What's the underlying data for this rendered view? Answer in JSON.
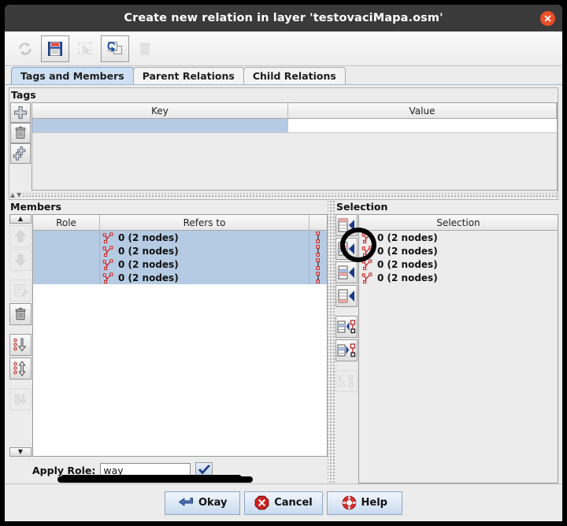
{
  "window": {
    "title": "Create new relation in layer 'testovaciMapa.osm'",
    "close_icon": "close-icon",
    "close_color": "#e8502a"
  },
  "toolbar": {
    "buttons": [
      {
        "name": "refresh-button",
        "icon": "refresh-icon",
        "enabled": false
      },
      {
        "name": "save-button",
        "icon": "save-floppy-icon",
        "enabled": true
      },
      {
        "name": "select-button",
        "icon": "select-cursor-icon",
        "enabled": false
      },
      {
        "name": "duplicate-button",
        "icon": "duplicate-icon",
        "enabled": true
      },
      {
        "name": "delete-button",
        "icon": "trash-icon",
        "enabled": false
      }
    ]
  },
  "tabs": [
    {
      "label": "Tags and Members",
      "active": true
    },
    {
      "label": "Parent Relations",
      "active": false
    },
    {
      "label": "Child Relations",
      "active": false
    }
  ],
  "tags": {
    "title": "Tags",
    "columns": [
      "Key",
      "Value"
    ],
    "rows": [
      {
        "key": "",
        "value": ""
      }
    ],
    "buttons": [
      {
        "name": "add-tag-button",
        "icon": "plus-icon",
        "enabled": true
      },
      {
        "name": "delete-tag-button",
        "icon": "trash-icon",
        "enabled": true
      },
      {
        "name": "add-many-tags-button",
        "icon": "multi-plus-icon",
        "enabled": true
      }
    ]
  },
  "members": {
    "title": "Members",
    "columns": [
      "Role",
      "Refers to",
      ""
    ],
    "rows": [
      {
        "role": "",
        "refers_to": "0 (2 nodes)",
        "icon": "way-icon",
        "link_icon": "two-nodes-icon",
        "selected": true
      },
      {
        "role": "",
        "refers_to": "0 (2 nodes)",
        "icon": "way-icon",
        "link_icon": "two-nodes-icon",
        "selected": true
      },
      {
        "role": "",
        "refers_to": "0 (2 nodes)",
        "icon": "way-icon",
        "link_icon": "two-nodes-icon",
        "selected": true
      },
      {
        "role": "",
        "refers_to": "0 (2 nodes)",
        "icon": "way-icon",
        "link_icon": "two-nodes-icon",
        "selected": true
      }
    ],
    "selected_row_color": "#b5cbe3",
    "rail_buttons": [
      {
        "name": "scroll-up-button",
        "icon": "triangle-up-icon",
        "enabled": true
      },
      {
        "name": "move-member-up-button",
        "icon": "arrow-up-icon",
        "enabled": false
      },
      {
        "name": "move-member-down-button",
        "icon": "arrow-down-icon",
        "enabled": false
      },
      {
        "name": "edit-member-button",
        "icon": "edit-note-icon",
        "enabled": false
      },
      {
        "name": "remove-member-button",
        "icon": "trash-icon",
        "enabled": true
      },
      {
        "name": "sort-members-button",
        "icon": "sort-down-icon",
        "enabled": true
      },
      {
        "name": "reverse-members-button",
        "icon": "reverse-updown-icon",
        "enabled": true
      },
      {
        "name": "download-members-button",
        "icon": "download-icon",
        "enabled": false
      },
      {
        "name": "scroll-down-button",
        "icon": "triangle-down-icon",
        "enabled": true
      }
    ],
    "apply_role": {
      "label": "Apply Role:",
      "value": "way",
      "placeholder": "",
      "ok_icon": "checkmark-icon"
    }
  },
  "selection": {
    "title": "Selection",
    "column": "Selection",
    "rows": [
      {
        "text": "0 (2 nodes)",
        "icon": "way-icon"
      },
      {
        "text": "0 (2 nodes)",
        "icon": "way-icon"
      },
      {
        "text": "0 (2 nodes)",
        "icon": "way-icon"
      },
      {
        "text": "0 (2 nodes)",
        "icon": "way-icon"
      }
    ],
    "row_color": "#e9f5b4",
    "rail_buttons": [
      {
        "name": "add-selection-to-top-button",
        "icon": "add-top-icon",
        "enabled": true,
        "annotated": true
      },
      {
        "name": "add-selection-above-button",
        "icon": "add-above-icon",
        "enabled": true
      },
      {
        "name": "add-selection-below-button",
        "icon": "add-below-icon",
        "enabled": true
      },
      {
        "name": "add-selection-to-bottom-button",
        "icon": "add-bottom-icon",
        "enabled": true
      },
      {
        "name": "select-members-button",
        "icon": "members-to-selection-icon",
        "enabled": true
      },
      {
        "name": "select-in-map-button",
        "icon": "selection-to-map-icon",
        "enabled": true
      },
      {
        "name": "download-incomplete-button",
        "icon": "download-incomplete-icon",
        "enabled": false
      }
    ]
  },
  "footer": {
    "buttons": [
      {
        "label": "Okay",
        "name": "okay-button",
        "icon": "enter-arrow-icon"
      },
      {
        "label": "Cancel",
        "name": "cancel-button",
        "icon": "cancel-octagon-icon"
      },
      {
        "label": "Help",
        "name": "help-button",
        "icon": "lifebuoy-icon"
      }
    ]
  },
  "annotation": {
    "type": "hand-drawn-circle",
    "color": "#000000",
    "target": "add-selection-to-top-button"
  }
}
